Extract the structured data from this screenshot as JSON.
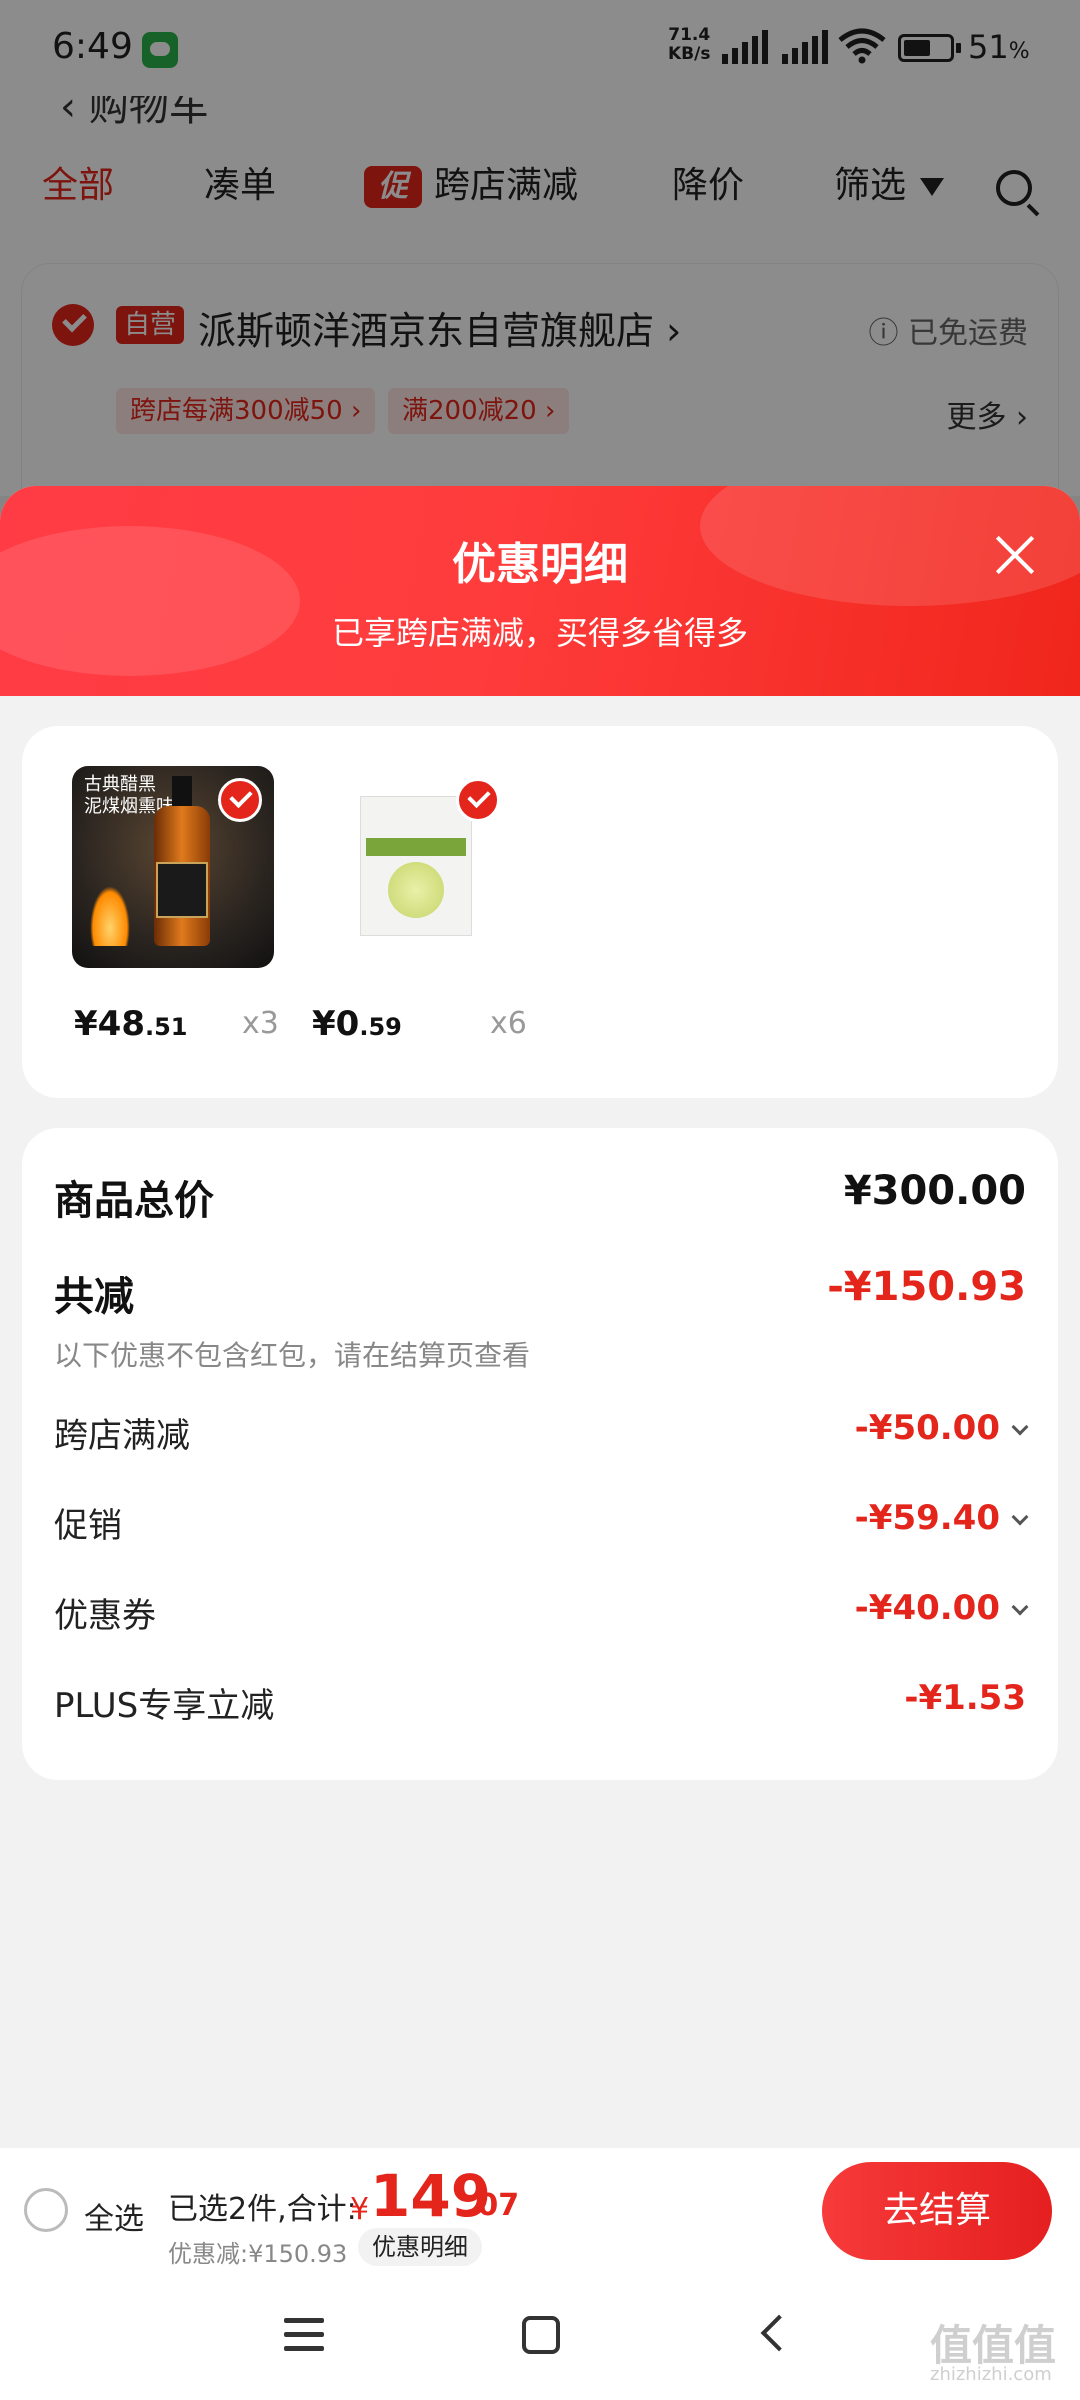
{
  "status_bar": {
    "time": "6:49",
    "net_speed_value": "71.4",
    "net_speed_unit": "KB/s",
    "battery_pct": "51",
    "battery_unit": "%"
  },
  "tabs": [
    {
      "label": "全部",
      "active": true
    },
    {
      "label": "凑单"
    },
    {
      "label": "跨店满减",
      "tag": "促"
    },
    {
      "label": "降价"
    },
    {
      "label": "筛选"
    }
  ],
  "store": {
    "self_tag": "自营",
    "name": "派斯顿洋酒京东自营旗舰店 ›",
    "shipping": "ⓘ 已免运费",
    "coupons": [
      "跨店每满300减50 ›",
      "满200减20 ›"
    ],
    "more": "更多 ›"
  },
  "sheet": {
    "title": "优惠明细",
    "subtitle": "已享跨店满减，买得多省得多"
  },
  "products": [
    {
      "image_text": "古典醋黑\n泥煤烟熏味",
      "price_int": "¥48",
      "price_dec": ".51",
      "qty": "x3"
    },
    {
      "price_int": "¥0",
      "price_dec": ".59",
      "qty": "x6"
    }
  ],
  "summary": {
    "total_label": "商品总价",
    "total_value": "¥300.00",
    "reduce_label": "共减",
    "reduce_value": "-¥150.93",
    "note": "以下优惠不包含红包，请在结算页查看",
    "items": [
      {
        "label": "跨店满减",
        "value": "-¥50.00"
      },
      {
        "label": "促销",
        "value": "-¥59.40"
      },
      {
        "label": "优惠券",
        "value": "-¥40.00"
      },
      {
        "label": "PLUS专享立减",
        "value": "-¥1.53"
      }
    ]
  },
  "bottom": {
    "select_all": "全选",
    "selected_info": "已选2件,合计:",
    "currency": "¥",
    "total_int": "149",
    "total_dec": ".07",
    "discount_info": "优惠减:¥150.93",
    "detail_chip": "优惠明细",
    "checkout": "去结算"
  },
  "watermark": {
    "text": "值值值",
    "sub": "zhizhizhi.com"
  },
  "colors": {
    "accent": "#e3251b"
  }
}
